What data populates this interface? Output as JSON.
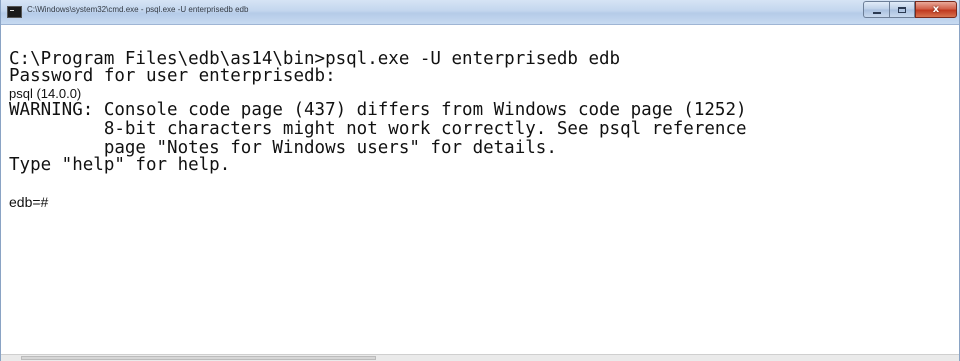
{
  "window": {
    "title": "C:\\Windows\\system32\\cmd.exe - psql.exe  -U enterprisedb edb",
    "controls": {
      "minimize_icon": "minimize-icon",
      "maximize_icon": "maximize-icon",
      "close_label": "x"
    }
  },
  "console": {
    "lines": [
      "C:\\Program Files\\edb\\as14\\bin>psql.exe -U enterprisedb edb",
      "Password for user enterprisedb:",
      "psql (14.0.0)",
      "WARNING: Console code page (437) differs from Windows code page (1252)",
      "         8-bit characters might not work correctly. See psql reference",
      "         page \"Notes for Windows users\" for details.",
      "Type \"help\" for help.",
      "",
      "edb=#"
    ]
  },
  "icons": {
    "app_icon": "cmd-icon"
  }
}
